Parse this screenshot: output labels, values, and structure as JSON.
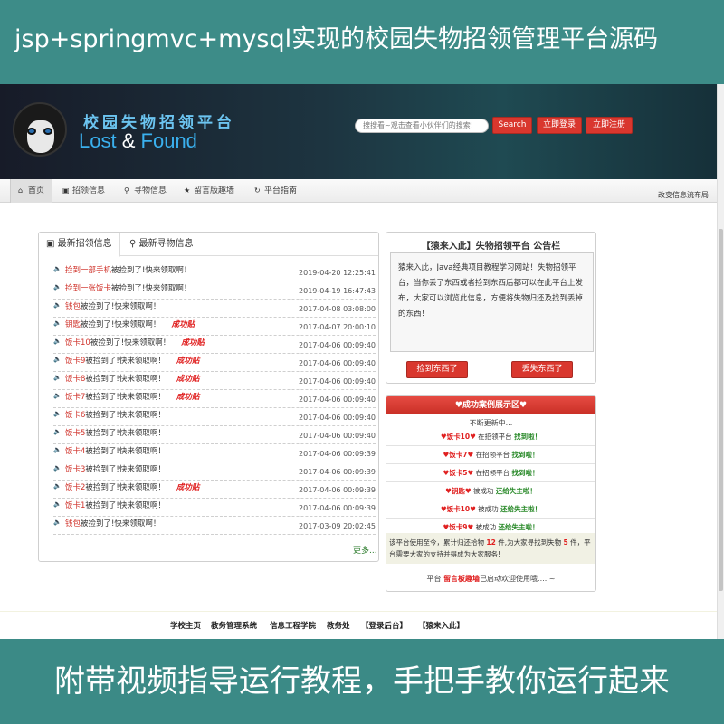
{
  "banner": {
    "top": "jsp+springmvc+mysql实现的校园失物招领管理平台源码",
    "bottom": "附带视频指导运行教程，手把手教你运行起来"
  },
  "header": {
    "brand_cn": "校园失物招领平台",
    "brand_en_1": "Lost",
    "brand_en_amp": "&",
    "brand_en_2": "Found",
    "search_placeholder": "搜搜看~观击查看小伙伴们的搜索!",
    "search_button": "Search",
    "login_button": "立即登录",
    "register_button": "立即注册"
  },
  "nav": {
    "items": [
      {
        "label": "首页",
        "icon": "home-icon"
      },
      {
        "label": "招领信息",
        "icon": "image-icon"
      },
      {
        "label": "寻物信息",
        "icon": "search-icon"
      },
      {
        "label": "留言版趣墙",
        "icon": "star-icon"
      },
      {
        "label": "平台指南",
        "icon": "refresh-icon"
      }
    ],
    "right_text": "改变信息流布局"
  },
  "tabs": {
    "found": "最新招领信息",
    "lost": "最新寻物信息"
  },
  "list": [
    {
      "highlight": "捡到一部手机",
      "text": "被捡到了!快来领取啊！",
      "badge": "",
      "date": "2019-04-20 12:25:41"
    },
    {
      "highlight": "捡到一张饭卡",
      "text": "被捡到了!快来领取啊！",
      "badge": "",
      "date": "2019-04-19 16:47:43"
    },
    {
      "highlight": "钱包",
      "text": "被捡到了!快来领取啊！",
      "badge": "",
      "date": "2017-04-08 03:08:00"
    },
    {
      "highlight": "钥匙",
      "text": "被捡到了!快来领取啊！",
      "badge": "成功贴",
      "date": "2017-04-07 20:00:10"
    },
    {
      "highlight": "饭卡10",
      "text": "被捡到了!快来领取啊！",
      "badge": "成功贴",
      "date": "2017-04-06 00:09:40"
    },
    {
      "highlight": "饭卡9",
      "text": "被捡到了!快来领取啊！",
      "badge": "成功贴",
      "date": "2017-04-06 00:09:40"
    },
    {
      "highlight": "饭卡8",
      "text": "被捡到了!快来领取啊！",
      "badge": "成功贴",
      "date": "2017-04-06 00:09:40"
    },
    {
      "highlight": "饭卡7",
      "text": "被捡到了!快来领取啊！",
      "badge": "成功贴",
      "date": "2017-04-06 00:09:40"
    },
    {
      "highlight": "饭卡6",
      "text": "被捡到了!快来领取啊！",
      "badge": "",
      "date": "2017-04-06 00:09:40"
    },
    {
      "highlight": "饭卡5",
      "text": "被捡到了!快来领取啊！",
      "badge": "",
      "date": "2017-04-06 00:09:40"
    },
    {
      "highlight": "饭卡4",
      "text": "被捡到了!快来领取啊！",
      "badge": "",
      "date": "2017-04-06 00:09:39"
    },
    {
      "highlight": "饭卡3",
      "text": "被捡到了!快来领取啊！",
      "badge": "",
      "date": "2017-04-06 00:09:39"
    },
    {
      "highlight": "饭卡2",
      "text": "被捡到了!快来领取啊！",
      "badge": "成功贴",
      "date": "2017-04-06 00:09:39"
    },
    {
      "highlight": "饭卡1",
      "text": "被捡到了!快来领取啊！",
      "badge": "",
      "date": "2017-04-06 00:09:39"
    },
    {
      "highlight": "钱包",
      "text": "被捡到了!快来领取啊！",
      "badge": "",
      "date": "2017-03-09 20:02:45"
    }
  ],
  "more": "更多...",
  "notice": {
    "title": "【猿来入此】失物招领平台 公告栏",
    "body": "猿来入此，Java经典项目教程学习网站！失物招领平台，当你丢了东西或者捡到东西后都可以在此平台上发布，大家可以浏览此信息，方便将失物归还及找到丢掉的东西！",
    "found_button": "捡到东西了",
    "lost_button": "丢失东西了"
  },
  "cases": {
    "title": "♥成功案例展示区♥",
    "subtitle": "不断更新中...",
    "rows": [
      {
        "a": "♥饭卡10♥",
        "b": " 在招领平台 ",
        "c": "找到啦！"
      },
      {
        "a": "♥饭卡7♥",
        "b": " 在招领平台 ",
        "c": "找到啦！"
      },
      {
        "a": "♥饭卡5♥",
        "b": " 在招领平台 ",
        "c": "找到啦！"
      },
      {
        "a": "♥钥匙♥",
        "b": " 被成功 ",
        "c": "还给失主啦！"
      },
      {
        "a": "♥饭卡10♥",
        "b": " 被成功 ",
        "c": "还给失主啦！"
      },
      {
        "a": "♥饭卡9♥",
        "b": " 被成功 ",
        "c": "还给失主啦！"
      }
    ],
    "stats_1": "该平台使用至今，累计归还拾物 ",
    "stats_n1": "12",
    "stats_2": " 件,为大家寻找到失物 ",
    "stats_n2": "5",
    "stats_3": " 件，平台需要大家的支持并得成为大家服务!",
    "foot_1": "平台 ",
    "foot_link": "留言板趣墙",
    "foot_2": "已启动欢迎使用哦.....~"
  },
  "footer": {
    "links": [
      "学校主页",
      "教务管理系统",
      "信息工程学院",
      "教务处",
      "【登录后台】",
      "【猿来入此】"
    ]
  },
  "colors": {
    "banner": "#3b8a86",
    "accent_red": "#d9372e",
    "brand_blue": "#3ab0ee"
  }
}
